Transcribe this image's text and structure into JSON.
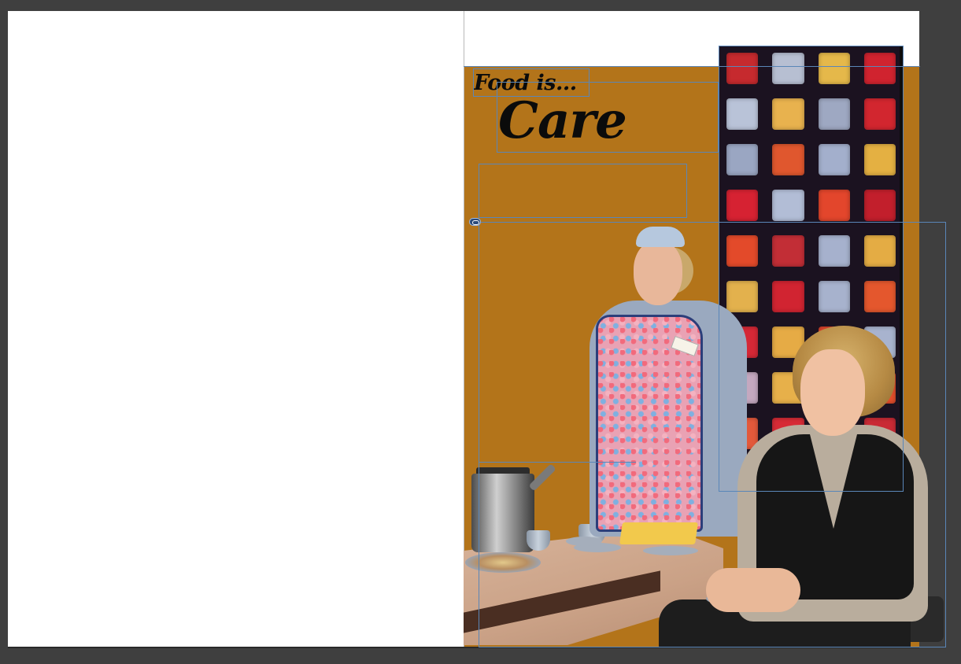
{
  "document": {
    "headline_prefix": "Food is...",
    "headline_main": "Care"
  },
  "colors": {
    "pasteboard": "#3f3f3f",
    "page": "#ffffff",
    "background_block": "#b3741a",
    "frame_outline": "#5a86b8",
    "headline_text": "#0b0b0b"
  },
  "quilt": {
    "cells": [
      "#c62a2e",
      "#b7bfd2",
      "#e5b84a",
      "#d0232f",
      "#b9c3d8",
      "#e8b24e",
      "#9ea8c2",
      "#d2262f",
      "#9aa6c2",
      "#e0572e",
      "#a3afcc",
      "#e4b042",
      "#d62232",
      "#b2bdd6",
      "#e3462c",
      "#c21f2c",
      "#e34a2a",
      "#c22e36",
      "#a6b1cd",
      "#e4ac44",
      "#e3b14d",
      "#d12431",
      "#a7b2cd",
      "#e4572d",
      "#d52836",
      "#e6ab45",
      "#e0462d",
      "#a8b3ce",
      "#c4a8bf",
      "#e7b04a",
      "#cf2733",
      "#e34e2c",
      "#e3593b",
      "#d72b36",
      "#e8b34b",
      "#c92a35",
      "#d42a34",
      "#e14c2d",
      "#d12632",
      "#b2bbd2"
    ]
  },
  "icons": {
    "link": "link-icon"
  }
}
